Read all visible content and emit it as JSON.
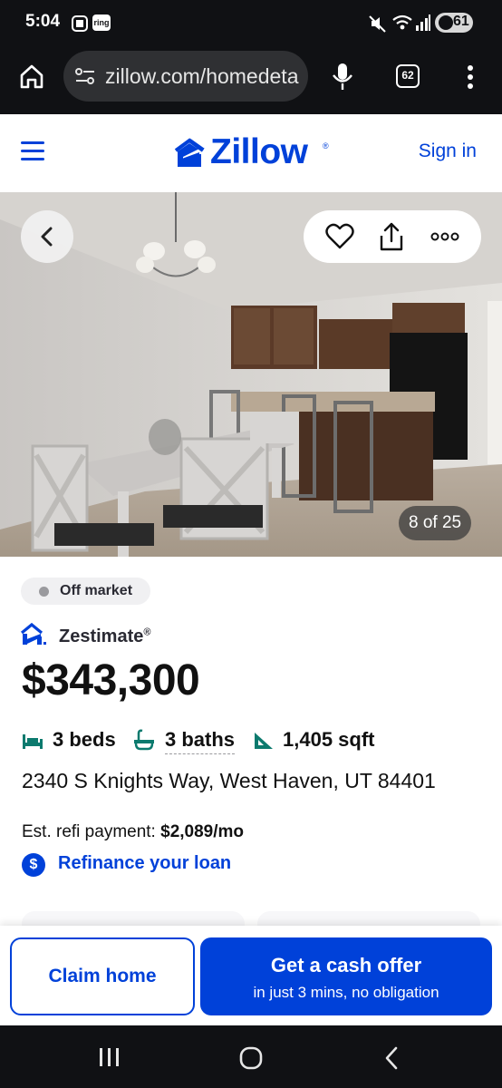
{
  "status_bar": {
    "time": "5:04",
    "ring_label": "ring",
    "battery": "61"
  },
  "browser": {
    "url": "zillow.com/homedeta",
    "tab_count": "62"
  },
  "header": {
    "logo": "Zillow",
    "sign_in": "Sign in"
  },
  "photo": {
    "counter": "8 of 25"
  },
  "listing": {
    "status": "Off market",
    "zestimate_label": "Zestimate",
    "zestimate_mark": "®",
    "price": "$343,300",
    "beds": "3 beds",
    "baths": "3 baths",
    "sqft": "1,405 sqft",
    "address": "2340 S Knights Way, West Haven, UT 84401",
    "refi_label": "Est. refi payment:",
    "refi_value": "$2,089/mo",
    "refi_link": "Refinance your loan",
    "refi_icon": "$"
  },
  "actions": {
    "claim": "Claim home",
    "cash_title": "Get a cash offer",
    "cash_sub": "in just 3 mins, no obligation"
  },
  "colors": {
    "brand": "#0041d9",
    "dark_bar": "#101114",
    "fact_icon": "#0c7a6e"
  },
  "icons": [
    "home-icon",
    "site-settings-icon",
    "mic-icon",
    "more-vert-icon",
    "menu-icon",
    "chevron-left-icon",
    "heart-icon",
    "share-icon",
    "more-horiz-icon",
    "bed-icon",
    "bath-icon",
    "sqft-icon",
    "dollar-icon",
    "recents-icon",
    "home-circle-icon",
    "back-icon"
  ]
}
